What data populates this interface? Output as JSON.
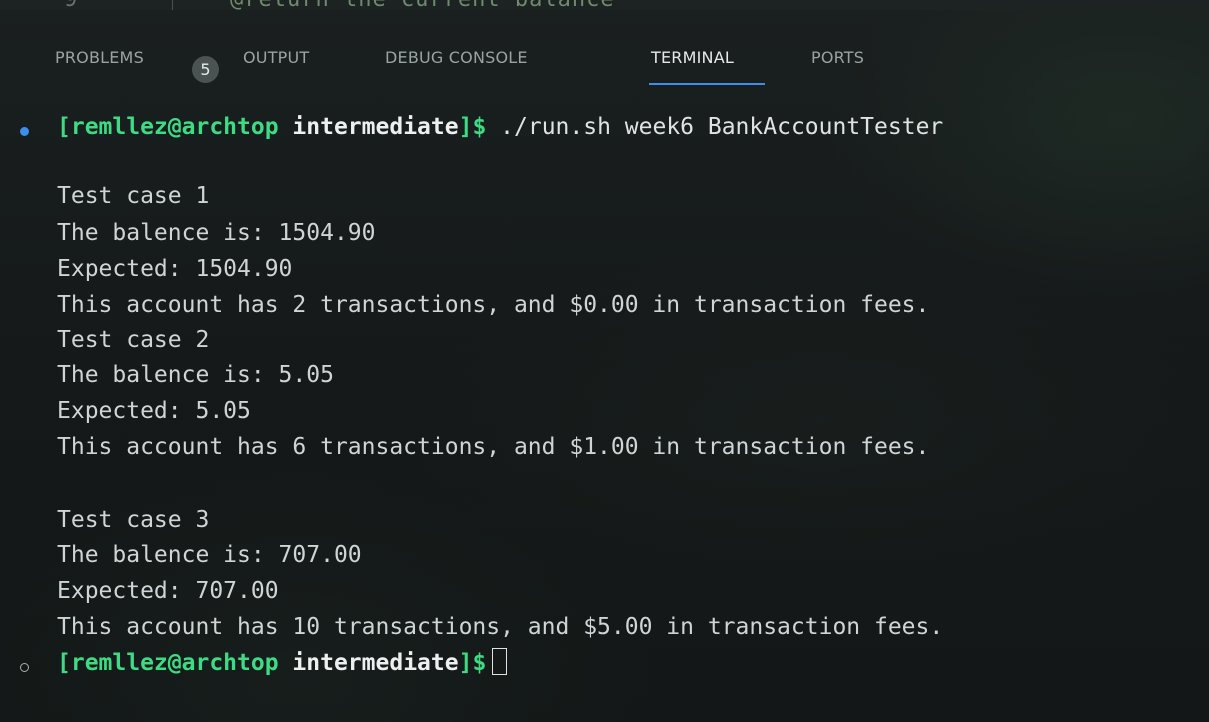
{
  "editor_peek": {
    "line_number": "9",
    "text": "@return the current balance"
  },
  "panel": {
    "tabs": [
      {
        "label": "PROBLEMS",
        "badge": "5"
      },
      {
        "label": "OUTPUT"
      },
      {
        "label": "DEBUG CONSOLE"
      },
      {
        "label": "TERMINAL"
      },
      {
        "label": "PORTS"
      }
    ],
    "active_tab": "TERMINAL",
    "accent_color": "#3b8eea"
  },
  "terminal": {
    "prompt": {
      "user_host": "[remllez@archtop",
      "directory": "intermediate",
      "suffix": "]$"
    },
    "command": "./run.sh week6 BankAccountTester",
    "output_lines": [
      "Test case 1",
      "The balence is: 1504.90",
      "Expected: 1504.90",
      "This account has 2 transactions, and $0.00 in transaction fees.",
      "Test case 2",
      "The balence is: 5.05",
      "Expected: 5.05",
      "This account has 6 transactions, and $1.00 in transaction fees.",
      "Test case 3",
      "The balence is: 707.00",
      "Expected: 707.00",
      "This account has 10 transactions, and $5.00 in transaction fees."
    ],
    "colors": {
      "prompt_green": "#3ddc84",
      "text": "#cfd4d4"
    }
  }
}
